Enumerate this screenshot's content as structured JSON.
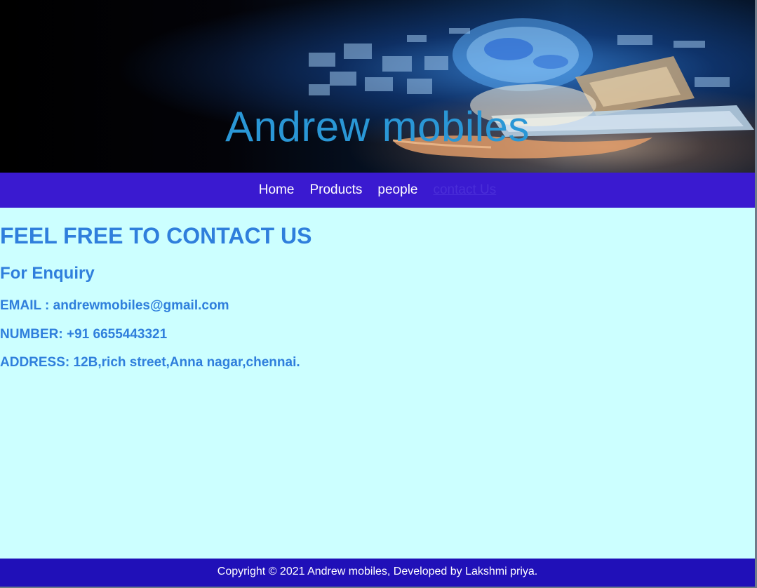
{
  "header": {
    "title": "Andrew mobiles",
    "image_icon": "hero-banner-technology-image"
  },
  "nav": {
    "items": [
      {
        "label": "Home",
        "active": false
      },
      {
        "label": "Products",
        "active": false
      },
      {
        "label": "people",
        "active": false
      },
      {
        "label": "contact Us",
        "active": true
      }
    ]
  },
  "main": {
    "heading": "FEEL FREE TO CONTACT US",
    "subheading": "For Enquiry",
    "email": "EMAIL : andrewmobiles@gmail.com",
    "number": "NUMBER: +91 6655443321",
    "address": "ADDRESS: 12B,rich street,Anna nagar,chennai."
  },
  "footer": {
    "text": "Copyright © 2021 Andrew mobiles, Developed by Lakshmi priya."
  },
  "colors": {
    "page_background": "#ccffff",
    "navbar": "#3a1ad0",
    "footer": "#2010b8",
    "title": "#2a97d6",
    "content_text": "#2f7fdc"
  }
}
